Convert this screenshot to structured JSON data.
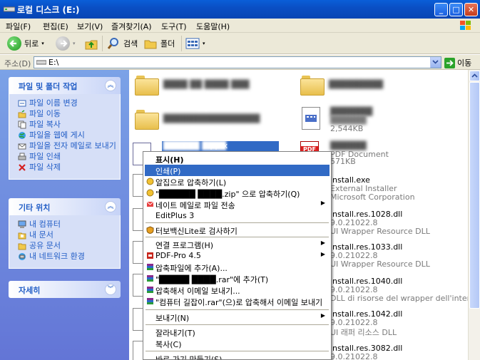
{
  "window": {
    "title": "로컬 디스크 (E:)",
    "minimize": "_",
    "maximize": "□",
    "close": "✕"
  },
  "menubar": {
    "items": [
      "파일(F)",
      "편집(E)",
      "보기(V)",
      "즐겨찾기(A)",
      "도구(T)",
      "도움말(H)"
    ]
  },
  "toolbar": {
    "back": "뒤로",
    "search": "검색",
    "folders": "폴더"
  },
  "address": {
    "label": "주소(D)",
    "value": "E:\\",
    "go": "이동"
  },
  "tasks": {
    "file_folder": {
      "title": "파일 및 폴더 작업",
      "items": [
        "파일 이름 변경",
        "파일 이동",
        "파일 복사",
        "파일을 웹에 게시",
        "파일을 전자 메일로 보내기",
        "파일 인쇄",
        "파일 삭제"
      ]
    },
    "other_places": {
      "title": "기타 위치",
      "items": [
        "내 컴퓨터",
        "내 문서",
        "공유 문서",
        "내 네트워크 환경"
      ]
    },
    "details": {
      "title": "자세히"
    }
  },
  "files": {
    "pptx_ext": ".pptx",
    "pdf_type": "PDF Document",
    "pdf_size": "571KB",
    "ini_size": "2,544KB",
    "install_exe": {
      "name": "install.exe",
      "desc": "External Installer",
      "company": "Microsoft Corporation"
    },
    "res1028": {
      "name": "install.res.1028.dll",
      "ver": "9.0.21022.8",
      "desc": "UI Wrapper Resource DLL"
    },
    "res1033": {
      "name": "install.res.1033.dll",
      "ver": "9.0.21022.8",
      "desc": "UI Wrapper Resource DLL"
    },
    "res1040": {
      "name": "install.res.1040.dll",
      "ver": "9.0.21022.8",
      "desc": "DLL di risorse del wrapper dell'interf..."
    },
    "res1042": {
      "name": "install.res.1042.dll",
      "ver": "9.0.21022.8",
      "desc": "UI 래퍼 리소스 DLL"
    },
    "res3082": {
      "name": "install.res.3082.dll",
      "ver": "9.0.21022.8"
    }
  },
  "context_menu": {
    "open": "표시(H)",
    "print": "인쇄(P)",
    "compress_alzip": "알집으로 압축하기(L)",
    "compress_zip": "\"██████ ████.zip\" 으로 압축하기(Q)",
    "nate_mail": "네이트 메일로 파일 전송",
    "editplus": "EditPlus 3",
    "turbo_vaccine": "터보백신Lite로 검사하기",
    "open_with": "연결 프로그램(H)",
    "pdf_pro": "PDF-Pro 4.5",
    "add_archive": "압축파일에 추가(A)...",
    "add_rar": "\"█████ ████.rar\"에 추가(T)",
    "compress_email": "압축해서 이메일 보내기...",
    "compress_rar_email": "\"컴퓨터 길잡이.rar\"(으)로 압축해서 이메일 보내기",
    "send_to": "보내기(N)",
    "cut": "잘라내기(T)",
    "copy": "복사(C)",
    "shortcut": "바로 가기 만들기(S)"
  }
}
